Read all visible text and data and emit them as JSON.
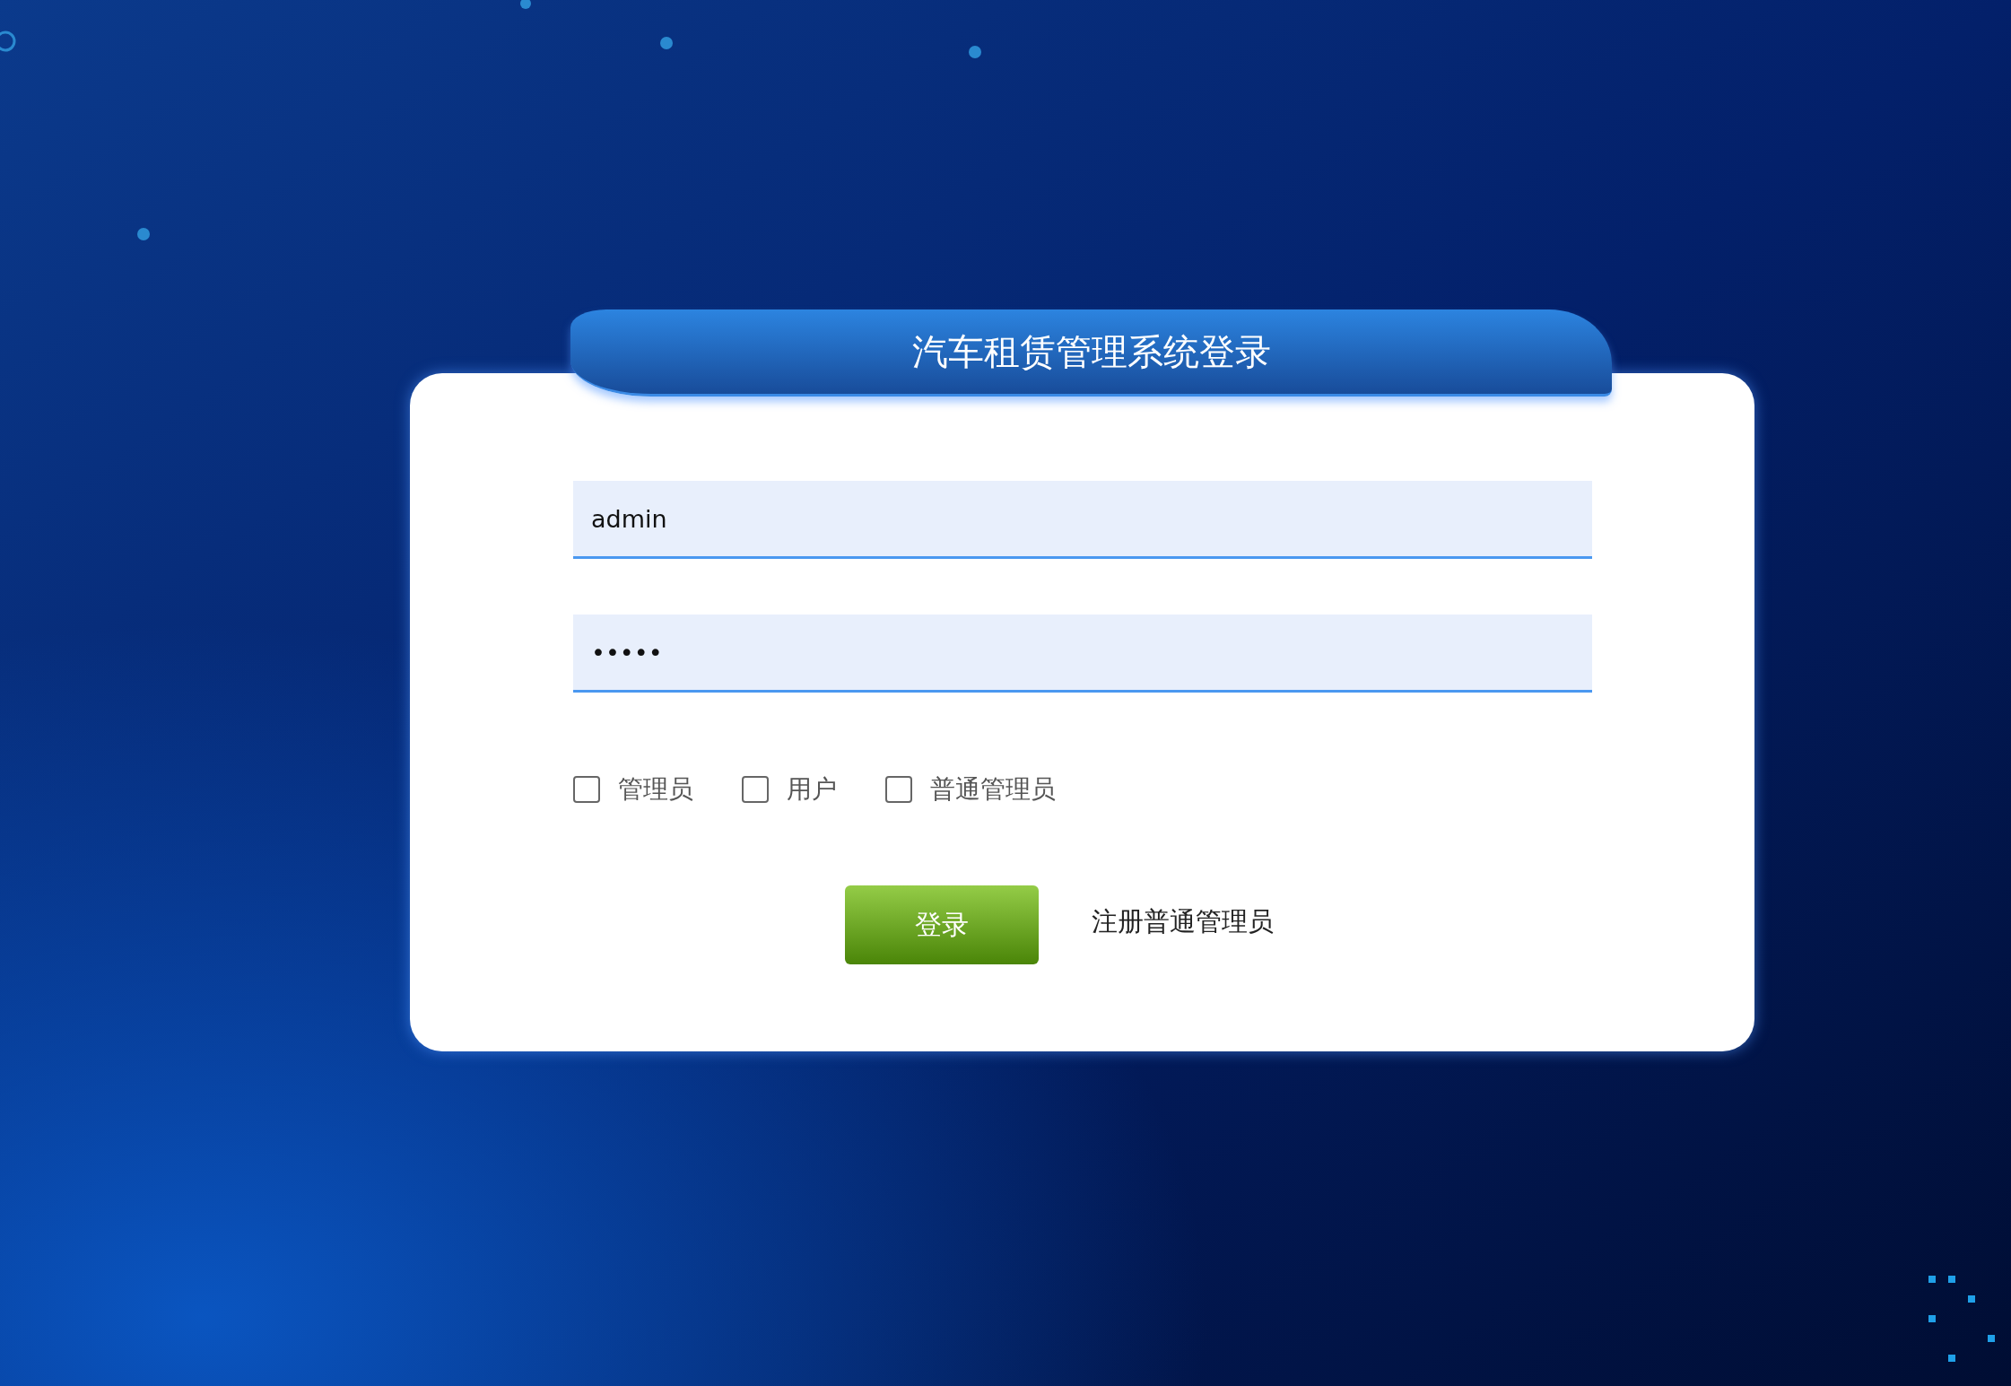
{
  "header": {
    "title": "汽车租赁管理系统登录"
  },
  "fields": [
    {
      "kind": "text",
      "value": "admin"
    },
    {
      "kind": "password",
      "value": "•••••"
    }
  ],
  "roles": [
    {
      "label": "管理员",
      "checked": false
    },
    {
      "label": "用户",
      "checked": false
    },
    {
      "label": "普通管理员",
      "checked": false
    }
  ],
  "login_button": "登录",
  "register_link": "注册普通管理员"
}
